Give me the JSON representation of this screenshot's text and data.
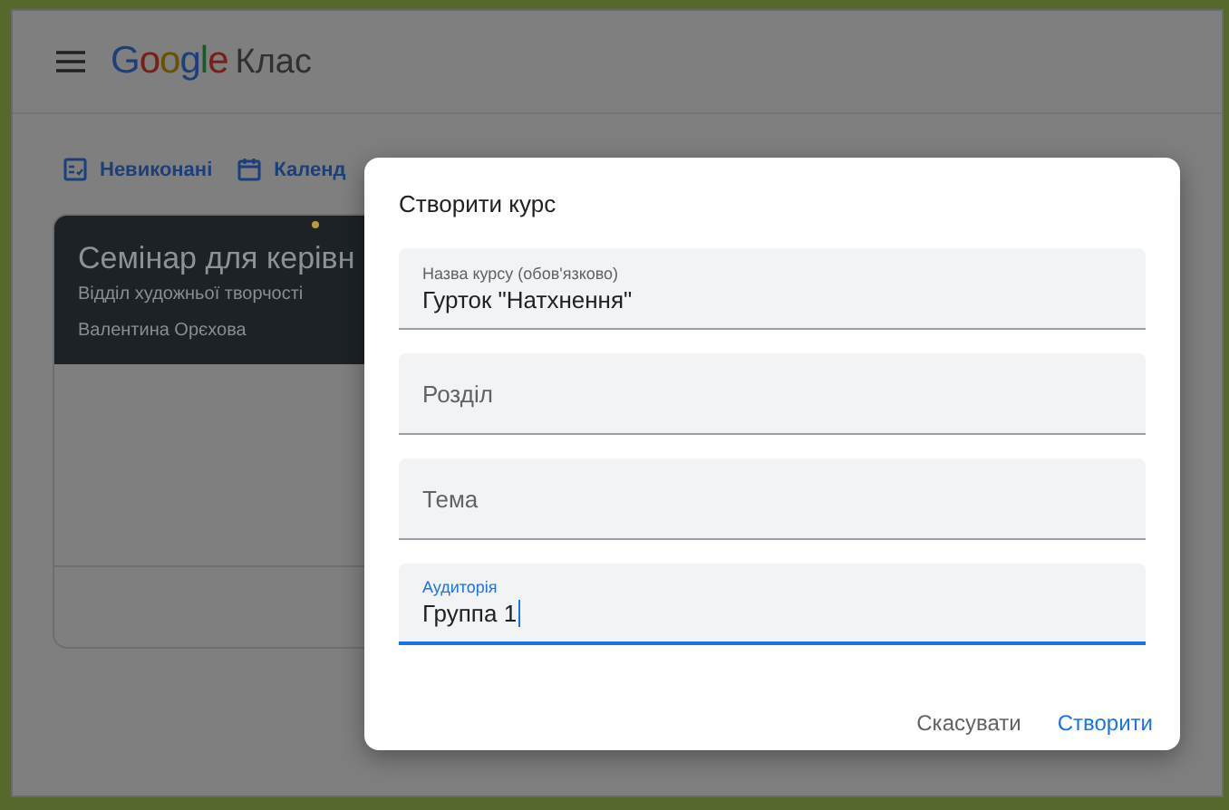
{
  "header": {
    "brand": "Google",
    "product": "Клас"
  },
  "nav": [
    {
      "label": "Невиконані"
    },
    {
      "label": "Календ"
    }
  ],
  "course_card": {
    "title": "Семінар для керівн",
    "section": "Відділ художньої творчості",
    "teacher": "Валентина Орєхова"
  },
  "dialog": {
    "title": "Створити курс",
    "fields": [
      {
        "kind": "filled",
        "label": "Назва курсу (обов'язково)",
        "value": "Гурток \"Натхнення\"",
        "focused": false
      },
      {
        "kind": "empty",
        "placeholder": "Розділ",
        "focused": false
      },
      {
        "kind": "empty",
        "placeholder": "Тема",
        "focused": false
      },
      {
        "kind": "filled",
        "label": "Аудиторія",
        "value": "Группа 1",
        "focused": true
      }
    ],
    "buttons": [
      {
        "label": "Скасувати",
        "kind": "secondary"
      },
      {
        "label": "Створити",
        "kind": "primary"
      }
    ]
  }
}
